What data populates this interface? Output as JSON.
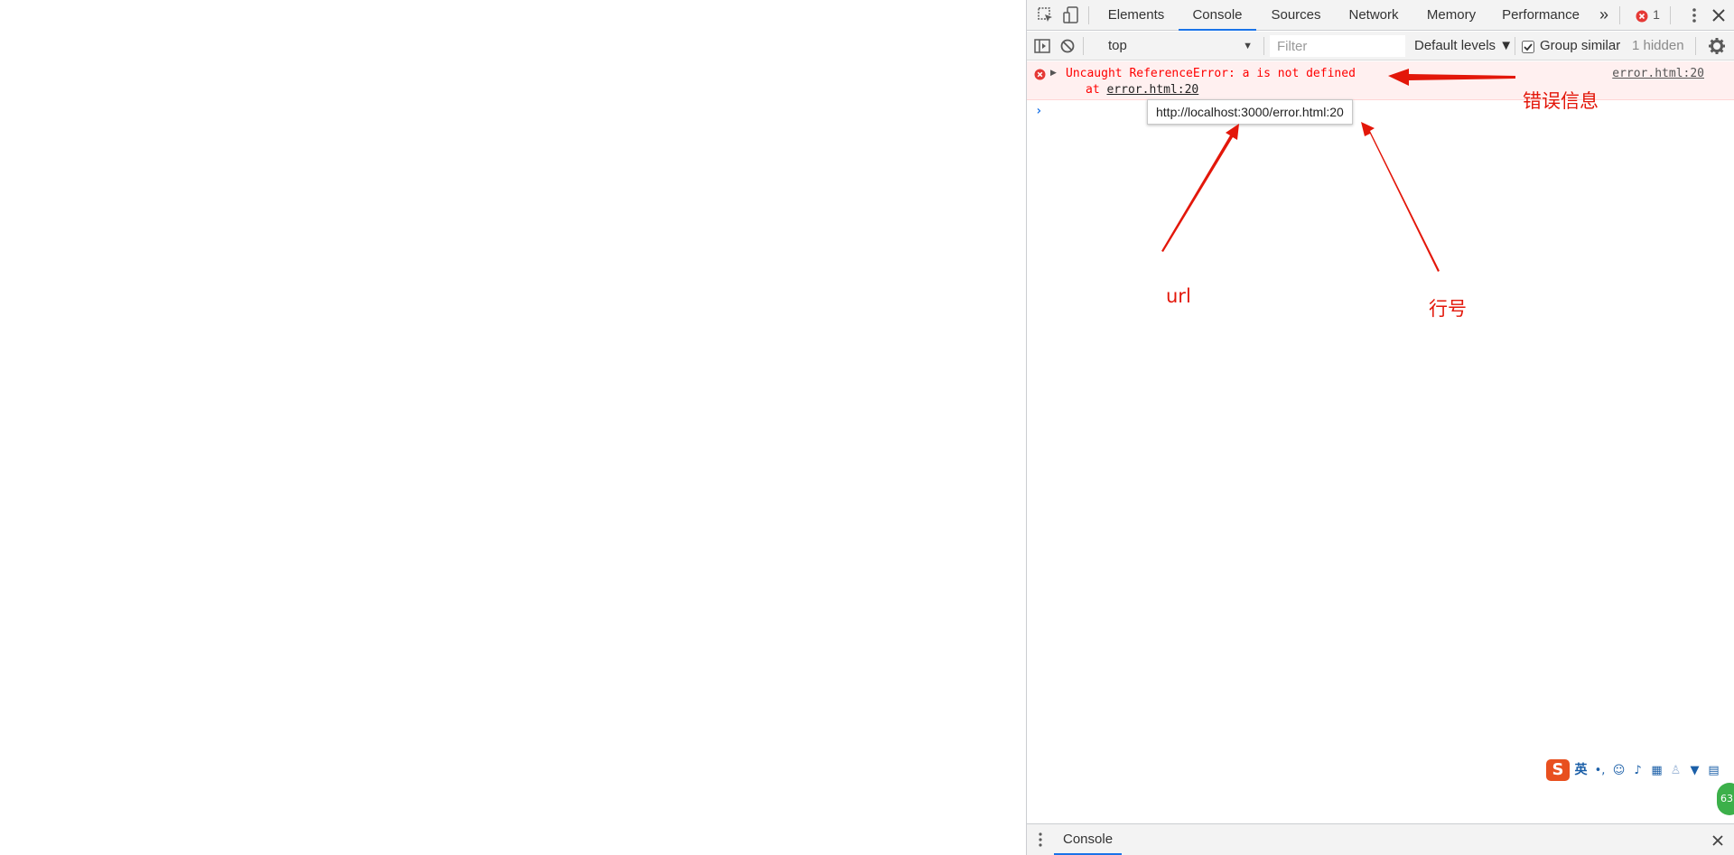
{
  "devtools": {
    "tabs": [
      "Elements",
      "Console",
      "Sources",
      "Network",
      "Memory",
      "Performance"
    ],
    "active_tab": "Console",
    "more_tabs_glyph": "»",
    "error_count": "1"
  },
  "console_toolbar": {
    "context": "top",
    "filter_placeholder": "Filter",
    "levels_label": "Default levels ▼",
    "group_similar_label": "Group similar",
    "group_similar_checked": true,
    "hidden_label": "1 hidden"
  },
  "error": {
    "message": "Uncaught ReferenceError: a is not defined",
    "stack_prefix": "at ",
    "stack_link": "error.html:20",
    "source_link": "error.html:20"
  },
  "tooltip": {
    "text": "http://localhost:3000/error.html:20"
  },
  "drawer": {
    "tab_label": "Console"
  },
  "annotations": {
    "error_info": "错误信息",
    "url": "url",
    "line_number": "行号",
    "color": "#e3170a"
  },
  "ime": {
    "lang": "英",
    "badge": "63"
  }
}
